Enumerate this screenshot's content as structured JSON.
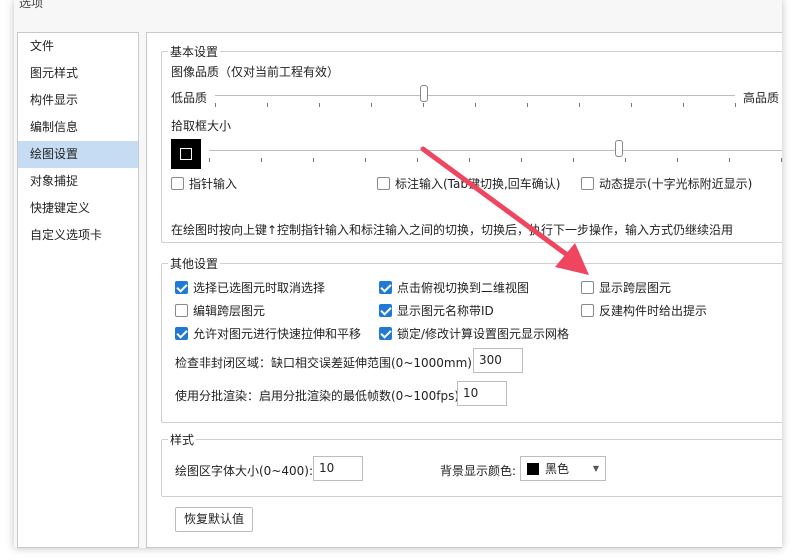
{
  "window": {
    "title_fragment": "选项"
  },
  "sidebar": {
    "items": [
      {
        "label": "文件"
      },
      {
        "label": "图元样式"
      },
      {
        "label": "构件显示"
      },
      {
        "label": "编制信息"
      },
      {
        "label": "绘图设置",
        "active": true
      },
      {
        "label": "对象捕捉"
      },
      {
        "label": "快捷键定义"
      },
      {
        "label": "自定义选项卡"
      }
    ]
  },
  "basic": {
    "legend": "基本设置",
    "quality_label": "图像品质（仅对当前工程有效）",
    "quality_low": "低品质",
    "quality_high": "高品质",
    "pickbox_label": "拾取框大小",
    "pointer_input": "指针输入",
    "dim_input": "标注输入(Tab键切换,回车确认)",
    "dynamic_prompt": "动态提示(十字光标附近显示)",
    "note": "在绘图时按向上键↑控制指针输入和标注输入之间的切换，切换后，执行下一步操作，输入方式仍继续沿用"
  },
  "other": {
    "legend": "其他设置",
    "checks": [
      {
        "label": "选择已选图元时取消选择",
        "checked": true
      },
      {
        "label": "点击俯视切换到二维视图",
        "checked": true
      },
      {
        "label": "显示跨层图元",
        "checked": false
      },
      {
        "label": "编辑跨层图元",
        "checked": false
      },
      {
        "label": "显示图元名称带ID",
        "checked": true
      },
      {
        "label": "反建构件时给出提示",
        "checked": false
      },
      {
        "label": "允许对图元进行快速拉伸和平移",
        "checked": true
      },
      {
        "label": "锁定/修改计算设置图元显示网格",
        "checked": true
      }
    ],
    "gap_label": "检查非封闭区域：缺口相交误差延伸范围(0~1000mm):",
    "gap_value": "300",
    "batch_label": "使用分批渲染：启用分批渲染的最低帧数(0~100fps):",
    "batch_value": "10"
  },
  "style": {
    "legend": "样式",
    "font_label": "绘图区字体大小(0~400):",
    "font_value": "10",
    "bg_label": "背景显示颜色:",
    "bg_value": "黑色"
  },
  "restore_button": "恢复默认值",
  "colors": {
    "accent": "#1e7ad6",
    "arrow": "#f0455f",
    "selected": "#c6dcf2"
  }
}
